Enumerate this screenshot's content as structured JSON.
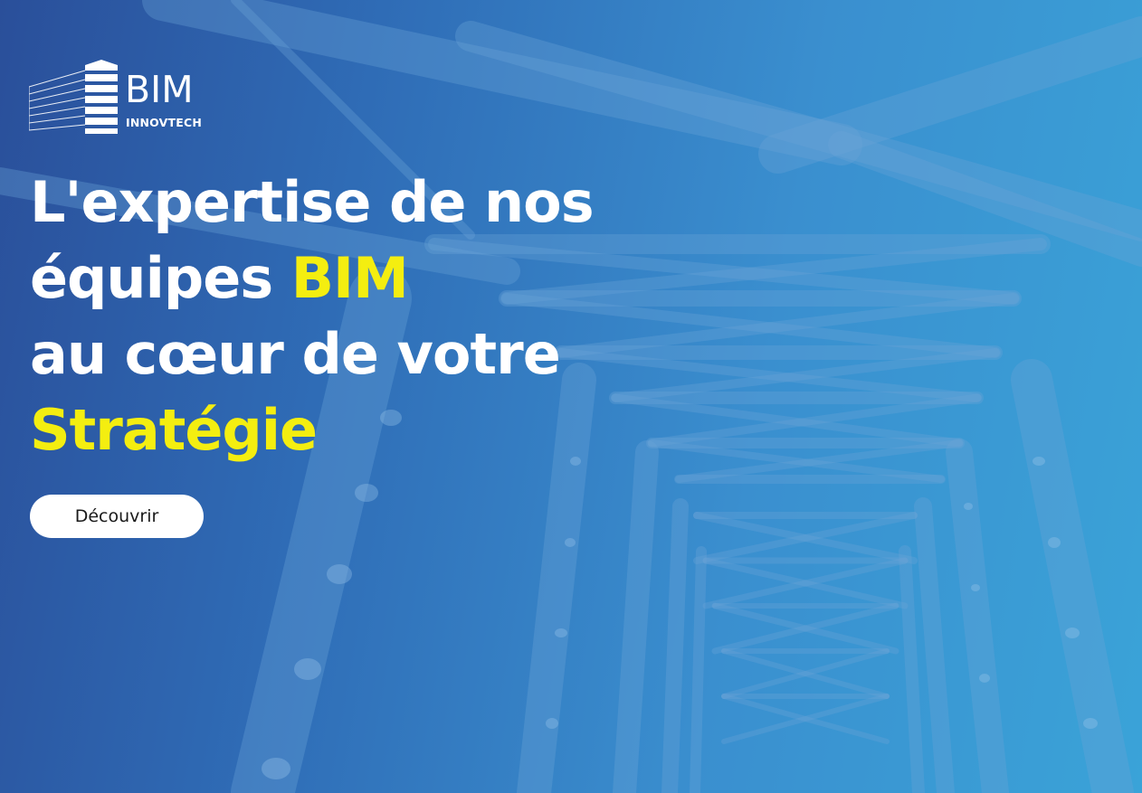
{
  "logo": {
    "name": "BIM",
    "tagline": "INNOVTECH"
  },
  "hero": {
    "line1": "L'expertise de nos",
    "line2_prefix": "équipes ",
    "line2_highlight": "BIM",
    "line3": "au cœur de votre",
    "line4_highlight": "Stratégie",
    "highlight_color": "#f4ee10",
    "cta_label": "Découvrir"
  },
  "background": {
    "icon": "steel-bridge-truss-image"
  }
}
